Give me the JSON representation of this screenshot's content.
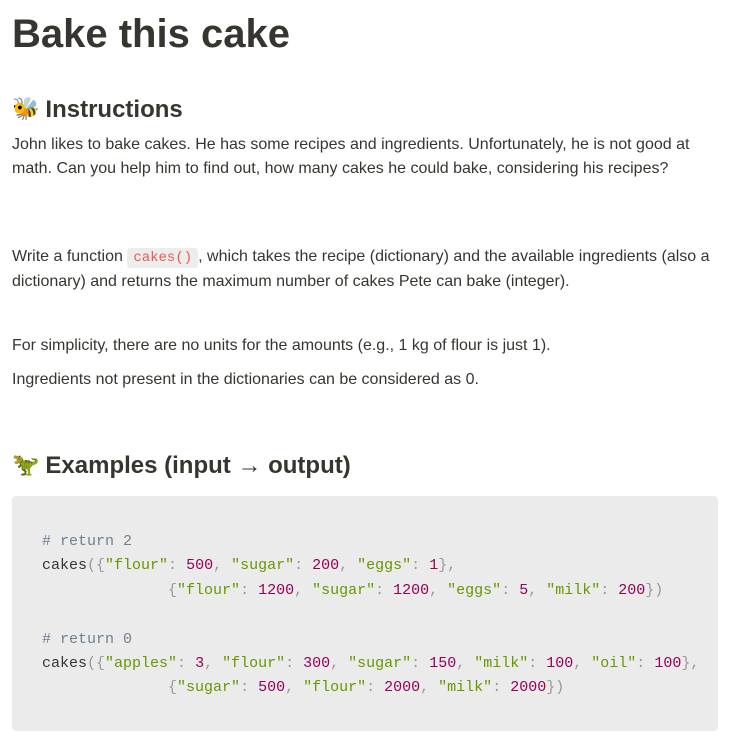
{
  "page": {
    "title": "Bake this cake"
  },
  "instructions": {
    "emoji": "🐝",
    "heading": "Instructions",
    "p1": "John likes to bake cakes. He has some recipes and ingredients. Unfortunately, he is not good at math. Can you help him to find out, how many cakes he could bake, considering his recipes?",
    "p2_before": "Write a function ",
    "p2_code": "cakes()",
    "p2_after": ", which takes the recipe (dictionary) and the available ingredients (also a dictionary) and returns the maximum number of cakes Pete can bake (integer).",
    "p3": "For simplicity, there are no units for the amounts (e.g., 1 kg of flour is just 1).",
    "p4": "Ingredients not present in the dictionaries can be considered as 0."
  },
  "examples": {
    "emoji": "🦖",
    "heading": "Examples (input → output)",
    "code_lines": [
      [
        {
          "t": "c-comment",
          "v": "# return 2"
        }
      ],
      [
        {
          "t": "c-plain",
          "v": "cakes"
        },
        {
          "t": "c-punct",
          "v": "({"
        },
        {
          "t": "c-str",
          "v": "\"flour\""
        },
        {
          "t": "c-punct",
          "v": ": "
        },
        {
          "t": "c-num",
          "v": "500"
        },
        {
          "t": "c-punct",
          "v": ", "
        },
        {
          "t": "c-str",
          "v": "\"sugar\""
        },
        {
          "t": "c-punct",
          "v": ": "
        },
        {
          "t": "c-num",
          "v": "200"
        },
        {
          "t": "c-punct",
          "v": ", "
        },
        {
          "t": "c-str",
          "v": "\"eggs\""
        },
        {
          "t": "c-punct",
          "v": ": "
        },
        {
          "t": "c-num",
          "v": "1"
        },
        {
          "t": "c-punct",
          "v": "},"
        }
      ],
      [
        {
          "t": "c-plain",
          "v": "              "
        },
        {
          "t": "c-punct",
          "v": "{"
        },
        {
          "t": "c-str",
          "v": "\"flour\""
        },
        {
          "t": "c-punct",
          "v": ": "
        },
        {
          "t": "c-num",
          "v": "1200"
        },
        {
          "t": "c-punct",
          "v": ", "
        },
        {
          "t": "c-str",
          "v": "\"sugar\""
        },
        {
          "t": "c-punct",
          "v": ": "
        },
        {
          "t": "c-num",
          "v": "1200"
        },
        {
          "t": "c-punct",
          "v": ", "
        },
        {
          "t": "c-str",
          "v": "\"eggs\""
        },
        {
          "t": "c-punct",
          "v": ": "
        },
        {
          "t": "c-num",
          "v": "5"
        },
        {
          "t": "c-punct",
          "v": ", "
        },
        {
          "t": "c-str",
          "v": "\"milk\""
        },
        {
          "t": "c-punct",
          "v": ": "
        },
        {
          "t": "c-num",
          "v": "200"
        },
        {
          "t": "c-punct",
          "v": "})"
        }
      ],
      [
        {
          "t": "c-plain",
          "v": ""
        }
      ],
      [
        {
          "t": "c-comment",
          "v": "# return 0"
        }
      ],
      [
        {
          "t": "c-plain",
          "v": "cakes"
        },
        {
          "t": "c-punct",
          "v": "({"
        },
        {
          "t": "c-str",
          "v": "\"apples\""
        },
        {
          "t": "c-punct",
          "v": ": "
        },
        {
          "t": "c-num",
          "v": "3"
        },
        {
          "t": "c-punct",
          "v": ", "
        },
        {
          "t": "c-str",
          "v": "\"flour\""
        },
        {
          "t": "c-punct",
          "v": ": "
        },
        {
          "t": "c-num",
          "v": "300"
        },
        {
          "t": "c-punct",
          "v": ", "
        },
        {
          "t": "c-str",
          "v": "\"sugar\""
        },
        {
          "t": "c-punct",
          "v": ": "
        },
        {
          "t": "c-num",
          "v": "150"
        },
        {
          "t": "c-punct",
          "v": ", "
        },
        {
          "t": "c-str",
          "v": "\"milk\""
        },
        {
          "t": "c-punct",
          "v": ": "
        },
        {
          "t": "c-num",
          "v": "100"
        },
        {
          "t": "c-punct",
          "v": ", "
        },
        {
          "t": "c-str",
          "v": "\"oil\""
        },
        {
          "t": "c-punct",
          "v": ": "
        },
        {
          "t": "c-num",
          "v": "100"
        },
        {
          "t": "c-punct",
          "v": "},"
        }
      ],
      [
        {
          "t": "c-plain",
          "v": "              "
        },
        {
          "t": "c-punct",
          "v": "{"
        },
        {
          "t": "c-str",
          "v": "\"sugar\""
        },
        {
          "t": "c-punct",
          "v": ": "
        },
        {
          "t": "c-num",
          "v": "500"
        },
        {
          "t": "c-punct",
          "v": ", "
        },
        {
          "t": "c-str",
          "v": "\"flour\""
        },
        {
          "t": "c-punct",
          "v": ": "
        },
        {
          "t": "c-num",
          "v": "2000"
        },
        {
          "t": "c-punct",
          "v": ", "
        },
        {
          "t": "c-str",
          "v": "\"milk\""
        },
        {
          "t": "c-punct",
          "v": ": "
        },
        {
          "t": "c-num",
          "v": "2000"
        },
        {
          "t": "c-punct",
          "v": "})"
        }
      ]
    ]
  },
  "colors": {
    "text": "#37352f",
    "inline_code_text": "#eb5757",
    "code_background": "#ebebeb",
    "code_string": "#669900",
    "code_number": "#990055",
    "code_comment": "#708090"
  }
}
